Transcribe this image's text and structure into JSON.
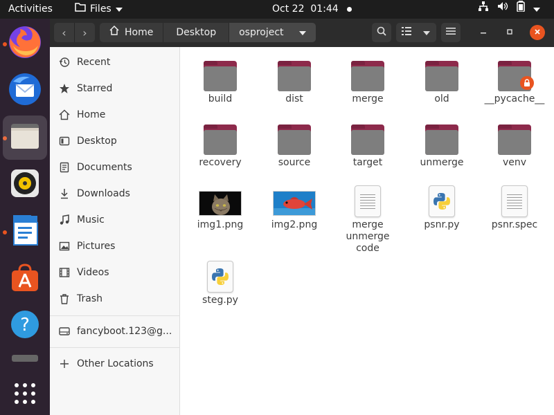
{
  "topbar": {
    "activities": "Activities",
    "app_menu": "Files",
    "clock": "Oct 22  01:44"
  },
  "dock": {
    "apps": [
      {
        "name": "Firefox",
        "icon": "firefox-icon",
        "running": true
      },
      {
        "name": "Thunderbird",
        "icon": "thunderbird-icon",
        "running": false
      },
      {
        "name": "Files",
        "icon": "files-icon",
        "running": true,
        "active": true
      },
      {
        "name": "Rhythmbox",
        "icon": "rhythmbox-icon",
        "running": false
      },
      {
        "name": "LibreOffice Writer",
        "icon": "writer-icon",
        "running": true
      },
      {
        "name": "Ubuntu Software",
        "icon": "software-icon",
        "running": false
      },
      {
        "name": "Help",
        "icon": "help-icon",
        "running": false
      },
      {
        "name": "Drive",
        "icon": "drive-icon",
        "running": false
      },
      {
        "name": "Show Applications",
        "icon": "app-grid-icon",
        "running": false
      }
    ]
  },
  "header": {
    "breadcrumbs": [
      "Home",
      "Desktop",
      "osproject"
    ]
  },
  "sidebar": {
    "items": [
      {
        "label": "Recent",
        "icon": "recent-icon"
      },
      {
        "label": "Starred",
        "icon": "star-icon"
      },
      {
        "label": "Home",
        "icon": "home-icon"
      },
      {
        "label": "Desktop",
        "icon": "desktop-icon"
      },
      {
        "label": "Documents",
        "icon": "documents-icon"
      },
      {
        "label": "Downloads",
        "icon": "downloads-icon"
      },
      {
        "label": "Music",
        "icon": "music-icon"
      },
      {
        "label": "Pictures",
        "icon": "pictures-icon"
      },
      {
        "label": "Videos",
        "icon": "videos-icon"
      },
      {
        "label": "Trash",
        "icon": "trash-icon"
      }
    ],
    "account": {
      "label": "fancyboot.123@g...",
      "icon": "online-account-icon"
    },
    "other": {
      "label": "Other Locations",
      "icon": "plus-icon"
    }
  },
  "files": [
    {
      "name": "build",
      "type": "folder"
    },
    {
      "name": "dist",
      "type": "folder"
    },
    {
      "name": "merge",
      "type": "folder"
    },
    {
      "name": "old",
      "type": "folder"
    },
    {
      "name": "__pycache__",
      "type": "folder-locked"
    },
    {
      "name": "recovery",
      "type": "folder"
    },
    {
      "name": "source",
      "type": "folder"
    },
    {
      "name": "target",
      "type": "folder"
    },
    {
      "name": "unmerge",
      "type": "folder"
    },
    {
      "name": "venv",
      "type": "folder"
    },
    {
      "name": "img1.png",
      "type": "image-cat"
    },
    {
      "name": "img2.png",
      "type": "image-fish"
    },
    {
      "name": "merge unmerge code",
      "type": "text"
    },
    {
      "name": "psnr.py",
      "type": "python"
    },
    {
      "name": "psnr.spec",
      "type": "text"
    },
    {
      "name": "steg.py",
      "type": "python"
    }
  ],
  "colors": {
    "accent": "#e95420",
    "folder_tab": "#8d2a4b",
    "folder_body": "#7e7e7e",
    "dock_bg": "#2d2230"
  }
}
